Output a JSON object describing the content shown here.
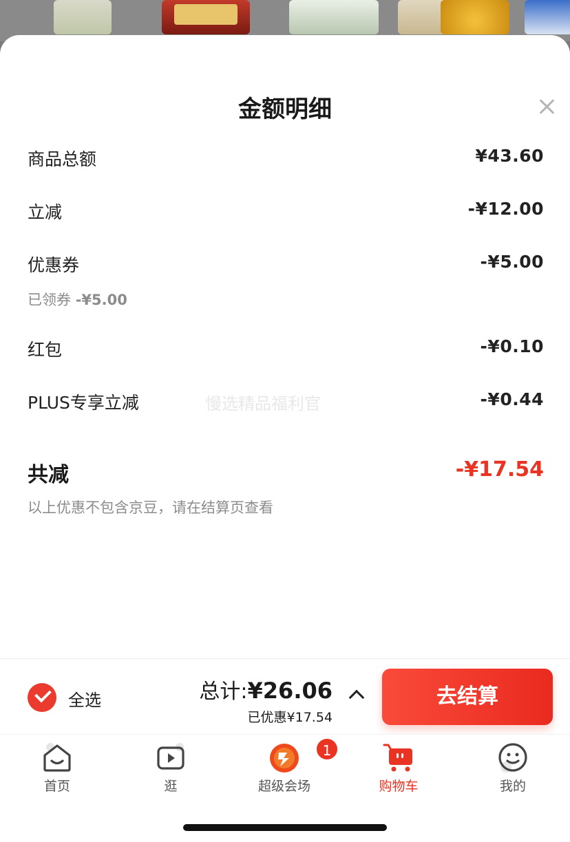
{
  "sheet": {
    "title": "金额明细"
  },
  "rows": [
    {
      "label": "商品总额",
      "value": "¥43.60"
    },
    {
      "label": "立减",
      "value": "-¥12.00"
    },
    {
      "label": "优惠券",
      "value": "-¥5.00"
    },
    {
      "label": "红包",
      "value": "-¥0.10"
    },
    {
      "label": "PLUS专享立减",
      "value": "-¥0.44"
    }
  ],
  "coupon_sub": {
    "label": "已领券",
    "value": "-¥5.00"
  },
  "watermark": "慢选精品福利官",
  "total_discount": {
    "label": "共减",
    "value": "-¥17.54",
    "note": "以上优惠不包含京豆，请在结算页查看"
  },
  "checkout": {
    "select_all": "全选",
    "total_label": "总计:",
    "total_value": "¥26.06",
    "saved": "已优惠¥17.54",
    "button": "去结算"
  },
  "tabs": [
    {
      "label": "首页",
      "icon": "home-icon"
    },
    {
      "label": "逛",
      "icon": "play-icon"
    },
    {
      "label": "超级会场",
      "icon": "super-venue-icon",
      "badge": "1"
    },
    {
      "label": "购物车",
      "icon": "cart-icon"
    },
    {
      "label": "我的",
      "icon": "smiley-icon"
    }
  ],
  "colors": {
    "accent": "#e93323",
    "button": "#f94a3a",
    "text_secondary": "#8c8c8c"
  }
}
